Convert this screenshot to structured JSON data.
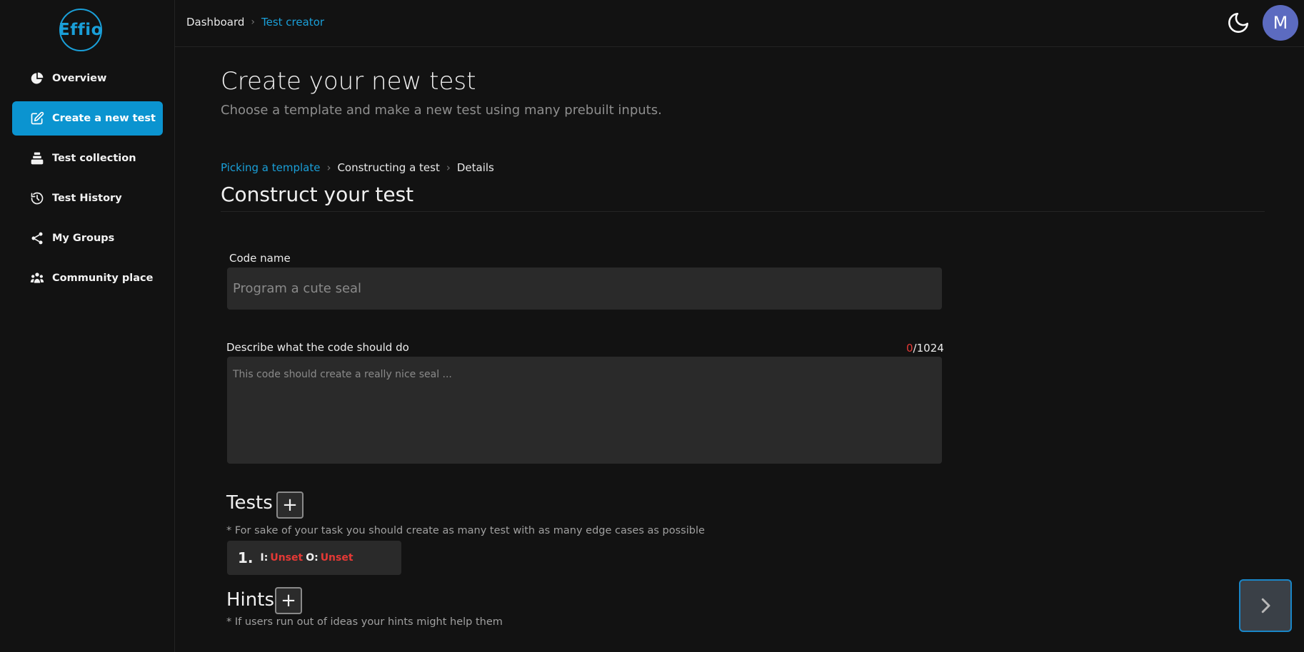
{
  "app": {
    "logo_text": "Effio",
    "brand_color": "#1a9fd8"
  },
  "sidebar": {
    "items": [
      {
        "label": "Overview",
        "icon": "pie-chart-icon",
        "active": false
      },
      {
        "label": "Create a new test",
        "icon": "edit-icon",
        "active": true
      },
      {
        "label": "Test collection",
        "icon": "stack-icon",
        "active": false
      },
      {
        "label": "Test History",
        "icon": "history-icon",
        "active": false
      },
      {
        "label": "My Groups",
        "icon": "share-icon",
        "active": false
      },
      {
        "label": "Community place",
        "icon": "community-icon",
        "active": false
      }
    ]
  },
  "topbar": {
    "breadcrumb": [
      "Dashboard",
      "Test creator"
    ],
    "theme_icon": "moon-icon",
    "avatar_initial": "M",
    "avatar_color": "#5c6bc0"
  },
  "main": {
    "title": "Create your new test",
    "subtitle": "Choose a template and make a new test using many prebuilt inputs.",
    "steps": [
      "Picking a template",
      "Constructing a test",
      "Details"
    ],
    "section_title": "Construct your test",
    "code_name": {
      "label": "Code name",
      "placeholder": "Program a cute seal",
      "value": ""
    },
    "description": {
      "label": "Describe what the code should do",
      "placeholder": "This code should create a really nice seal ...",
      "count": "0",
      "max": "/1024"
    },
    "tests": {
      "title": "Tests",
      "add_symbol": "+",
      "note": "* For sake of your task you should create as many test with as many edge cases as possible",
      "items": [
        {
          "number": "1.",
          "input_label": "I:",
          "input_value": "Unset",
          "output_label": "O:",
          "output_value": "Unset"
        }
      ]
    },
    "hints": {
      "title": "Hints",
      "add_symbol": "+",
      "note": "* If users run out of ideas your hints might help them"
    }
  },
  "next_button": {
    "icon": "chevron-right-icon"
  }
}
